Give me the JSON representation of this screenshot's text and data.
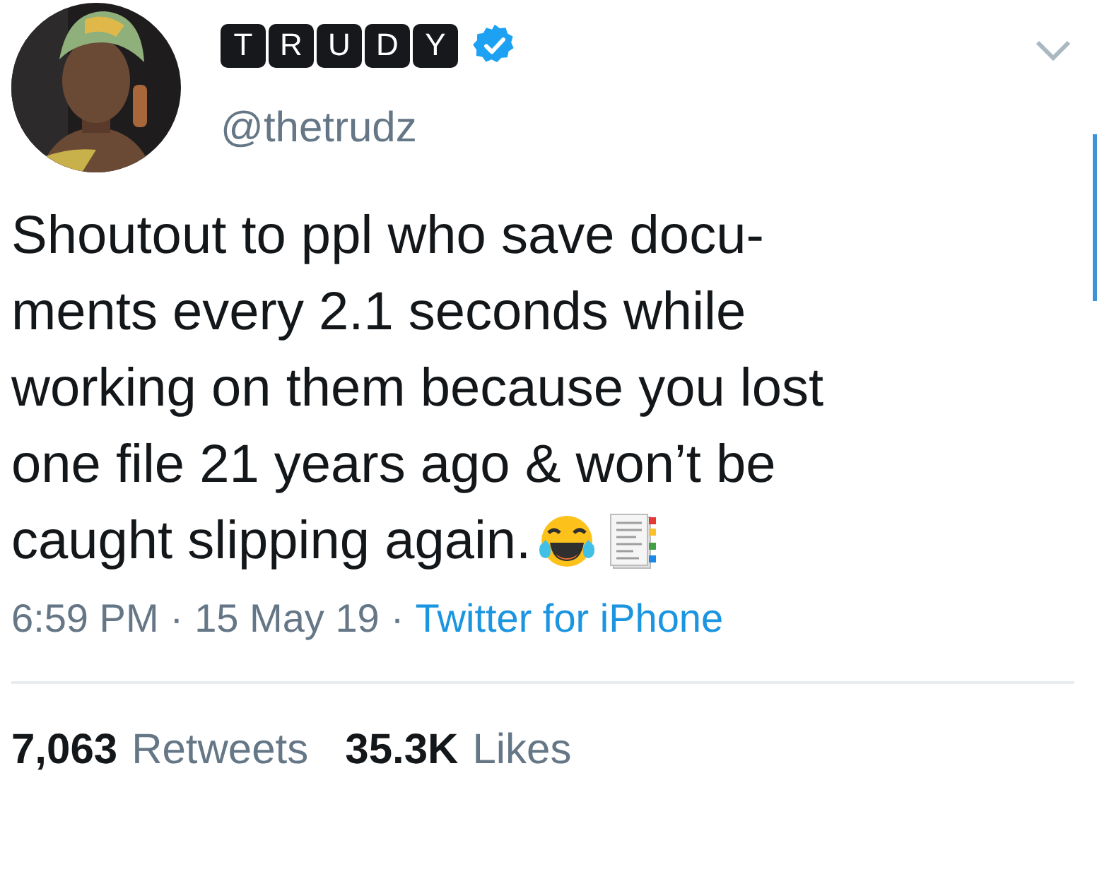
{
  "author": {
    "name_tiles": [
      "T",
      "R",
      "U",
      "D",
      "Y"
    ],
    "verified": true,
    "handle": "@thetrudz"
  },
  "tweet": {
    "lines": [
      "Shoutout to ppl who save docu-",
      "ments every 2.1 seconds while",
      "working on them because you lost",
      "one file 21 years ago & won’t be",
      "caught slipping again."
    ],
    "emojis": [
      {
        "kind": "laughing"
      },
      {
        "kind": "document"
      }
    ]
  },
  "meta": {
    "time": "6:59 PM",
    "separator_1": "·",
    "date": "15 May 19",
    "separator_2": "·",
    "source": "Twitter for iPhone"
  },
  "stats": [
    {
      "count": "7,063",
      "label": "Retweets"
    },
    {
      "count": "35.3K",
      "label": "Likes"
    }
  ]
}
